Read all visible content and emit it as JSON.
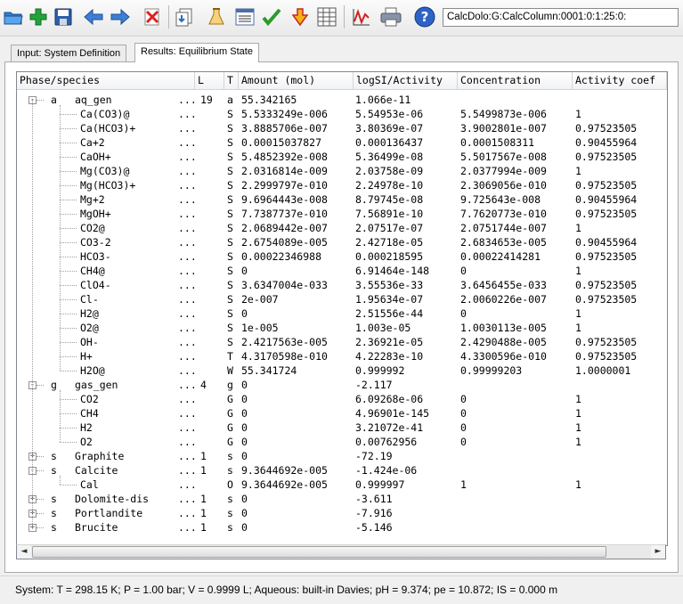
{
  "toolbar": {
    "icons": [
      "open-folder-icon",
      "add-icon",
      "save-icon",
      "back-arrow-icon",
      "forward-arrow-icon",
      "delete-icon",
      "import-icon",
      "flask-icon",
      "list-icon",
      "check-icon",
      "calculate-icon",
      "table-icon",
      "graph-icon",
      "print-icon",
      "help-icon"
    ],
    "address": "CalcDolo:G:CalcColumn:0001:0:1:25:0:"
  },
  "tabs": [
    {
      "label": "Input: System Definition",
      "active": false
    },
    {
      "label": "Results: Equilibrium State",
      "active": true
    }
  ],
  "columns": [
    "Phase/species",
    "L",
    "T",
    "Amount (mol)",
    "logSI/Activity",
    "Concentration",
    "Activity coef"
  ],
  "rows": [
    {
      "level": 0,
      "expander": "-",
      "prefix": "a",
      "name": "aq_gen",
      "dots": "...",
      "l": "19",
      "t": "a",
      "amount": "55.342165",
      "logsi": "1.066e-11",
      "conc": "",
      "coef": ""
    },
    {
      "level": 1,
      "name": "Ca(CO3)@",
      "dots": "...",
      "t": "S",
      "amount": "5.5333249e-006",
      "logsi": "5.54953e-06",
      "conc": "5.5499873e-006",
      "coef": "1"
    },
    {
      "level": 1,
      "name": "Ca(HCO3)+",
      "dots": "...",
      "t": "S",
      "amount": "3.8885706e-007",
      "logsi": "3.80369e-07",
      "conc": "3.9002801e-007",
      "coef": "0.97523505"
    },
    {
      "level": 1,
      "name": "Ca+2",
      "dots": "...",
      "t": "S",
      "amount": "0.00015037827",
      "logsi": "0.000136437",
      "conc": "0.0001508311",
      "coef": "0.90455964"
    },
    {
      "level": 1,
      "name": "CaOH+",
      "dots": "...",
      "t": "S",
      "amount": "5.4852392e-008",
      "logsi": "5.36499e-08",
      "conc": "5.5017567e-008",
      "coef": "0.97523505"
    },
    {
      "level": 1,
      "name": "Mg(CO3)@",
      "dots": "...",
      "t": "S",
      "amount": "2.0316814e-009",
      "logsi": "2.03758e-09",
      "conc": "2.0377994e-009",
      "coef": "1"
    },
    {
      "level": 1,
      "name": "Mg(HCO3)+",
      "dots": "...",
      "t": "S",
      "amount": "2.2999797e-010",
      "logsi": "2.24978e-10",
      "conc": "2.3069056e-010",
      "coef": "0.97523505"
    },
    {
      "level": 1,
      "name": "Mg+2",
      "dots": "...",
      "t": "S",
      "amount": "9.6964443e-008",
      "logsi": "8.79745e-08",
      "conc": "9.725643e-008",
      "coef": "0.90455964"
    },
    {
      "level": 1,
      "name": "MgOH+",
      "dots": "...",
      "t": "S",
      "amount": "7.7387737e-010",
      "logsi": "7.56891e-10",
      "conc": "7.7620773e-010",
      "coef": "0.97523505"
    },
    {
      "level": 1,
      "name": "CO2@",
      "dots": "...",
      "t": "S",
      "amount": "2.0689442e-007",
      "logsi": "2.07517e-07",
      "conc": "2.0751744e-007",
      "coef": "1"
    },
    {
      "level": 1,
      "name": "CO3-2",
      "dots": "...",
      "t": "S",
      "amount": "2.6754089e-005",
      "logsi": "2.42718e-05",
      "conc": "2.6834653e-005",
      "coef": "0.90455964"
    },
    {
      "level": 1,
      "name": "HCO3-",
      "dots": "...",
      "t": "S",
      "amount": "0.00022346988",
      "logsi": "0.000218595",
      "conc": "0.00022414281",
      "coef": "0.97523505"
    },
    {
      "level": 1,
      "name": "CH4@",
      "dots": "...",
      "t": "S",
      "amount": "0",
      "logsi": "6.91464e-148",
      "conc": "0",
      "coef": "1"
    },
    {
      "level": 1,
      "name": "ClO4-",
      "dots": "...",
      "t": "S",
      "amount": "3.6347004e-033",
      "logsi": "3.55536e-33",
      "conc": "3.6456455e-033",
      "coef": "0.97523505"
    },
    {
      "level": 1,
      "name": "Cl-",
      "dots": "...",
      "t": "S",
      "amount": "2e-007",
      "logsi": "1.95634e-07",
      "conc": "2.0060226e-007",
      "coef": "0.97523505"
    },
    {
      "level": 1,
      "name": "H2@",
      "dots": "...",
      "t": "S",
      "amount": "0",
      "logsi": "2.51556e-44",
      "conc": "0",
      "coef": "1"
    },
    {
      "level": 1,
      "name": "O2@",
      "dots": "...",
      "t": "S",
      "amount": "1e-005",
      "logsi": "1.003e-05",
      "conc": "1.0030113e-005",
      "coef": "1"
    },
    {
      "level": 1,
      "name": "OH-",
      "dots": "...",
      "t": "S",
      "amount": "2.4217563e-005",
      "logsi": "2.36921e-05",
      "conc": "2.4290488e-005",
      "coef": "0.97523505"
    },
    {
      "level": 1,
      "name": "H+",
      "dots": "...",
      "t": "T",
      "amount": "4.3170598e-010",
      "logsi": "4.22283e-10",
      "conc": "4.3300596e-010",
      "coef": "0.97523505"
    },
    {
      "level": 1,
      "name": "H2O@",
      "dots": "...",
      "t": "W",
      "amount": "55.341724",
      "logsi": "0.999992",
      "conc": "0.99999203",
      "coef": "1.0000001"
    },
    {
      "level": 0,
      "expander": "-",
      "prefix": "g",
      "name": "gas_gen",
      "dots": "...",
      "l": "4",
      "t": "g",
      "amount": "0",
      "logsi": "-2.117",
      "conc": "",
      "coef": ""
    },
    {
      "level": 1,
      "name": "CO2",
      "dots": "...",
      "t": "G",
      "amount": "0",
      "logsi": "6.09268e-06",
      "conc": "0",
      "coef": "1"
    },
    {
      "level": 1,
      "name": "CH4",
      "dots": "...",
      "t": "G",
      "amount": "0",
      "logsi": "4.96901e-145",
      "conc": "0",
      "coef": "1"
    },
    {
      "level": 1,
      "name": "H2",
      "dots": "...",
      "t": "G",
      "amount": "0",
      "logsi": "3.21072e-41",
      "conc": "0",
      "coef": "1"
    },
    {
      "level": 1,
      "name": "O2",
      "dots": "...",
      "t": "G",
      "amount": "0",
      "logsi": "0.00762956",
      "conc": "0",
      "coef": "1"
    },
    {
      "level": 0,
      "expander": "+",
      "prefix": "s",
      "name": "Graphite",
      "dots": "...",
      "l": "1",
      "t": "s",
      "amount": "0",
      "logsi": "-72.19",
      "conc": "",
      "coef": ""
    },
    {
      "level": 0,
      "expander": "-",
      "prefix": "s",
      "name": "Calcite",
      "dots": "...",
      "l": "1",
      "t": "s",
      "amount": "9.3644692e-005",
      "logsi": "-1.424e-06",
      "conc": "",
      "coef": ""
    },
    {
      "level": 1,
      "name": "Cal",
      "dots": "...",
      "t": "O",
      "amount": "9.3644692e-005",
      "logsi": "0.999997",
      "conc": "1",
      "coef": "1"
    },
    {
      "level": 0,
      "expander": "+",
      "prefix": "s",
      "name": "Dolomite-dis",
      "dots": "...",
      "l": "1",
      "t": "s",
      "amount": "0",
      "logsi": "-3.611",
      "conc": "",
      "coef": ""
    },
    {
      "level": 0,
      "expander": "+",
      "prefix": "s",
      "name": "Portlandite",
      "dots": "...",
      "l": "1",
      "t": "s",
      "amount": "0",
      "logsi": "-7.916",
      "conc": "",
      "coef": ""
    },
    {
      "level": 0,
      "expander": "+",
      "prefix": "s",
      "name": "Brucite",
      "dots": "...",
      "l": "1",
      "t": "s",
      "amount": "0",
      "logsi": "-5.146",
      "conc": "",
      "coef": ""
    }
  ],
  "scrollbar": {
    "left_arrow": "◄",
    "right_arrow": "►"
  },
  "status": "System:  T =  298.15 K;  P =    1.00 bar;  V =    0.9999 L;  Aqueous: built-in Davies;  pH =  9.374;  pe =  10.872;  IS =  0.000 m"
}
